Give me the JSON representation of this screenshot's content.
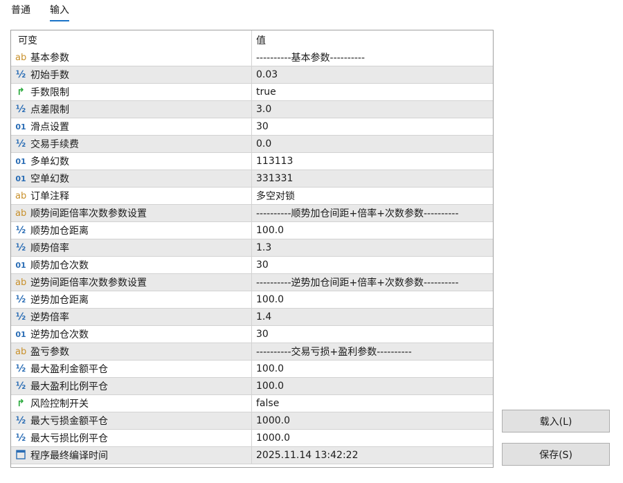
{
  "tabs": [
    {
      "label": "普通",
      "active": false
    },
    {
      "label": "输入",
      "active": true
    }
  ],
  "table": {
    "headers": {
      "name": "可变",
      "value": "值"
    },
    "rows": [
      {
        "type": "ab",
        "name": "基本参数",
        "value": "----------基本参数----------"
      },
      {
        "type": "half",
        "name": "初始手数",
        "value": "0.03"
      },
      {
        "type": "bool",
        "name": "手数限制",
        "value": "true"
      },
      {
        "type": "half",
        "name": "点差限制",
        "value": "3.0"
      },
      {
        "type": "01",
        "name": "滑点设置",
        "value": "30"
      },
      {
        "type": "half",
        "name": "交易手续费",
        "value": "0.0"
      },
      {
        "type": "01",
        "name": "多单幻数",
        "value": "113113"
      },
      {
        "type": "01",
        "name": "空单幻数",
        "value": "331331"
      },
      {
        "type": "ab",
        "name": "订单注释",
        "value": "多空对锁"
      },
      {
        "type": "ab",
        "name": "顺势间距倍率次数参数设置",
        "value": "----------顺势加仓间距+倍率+次数参数----------"
      },
      {
        "type": "half",
        "name": "顺势加仓距离",
        "value": "100.0"
      },
      {
        "type": "half",
        "name": "顺势倍率",
        "value": "1.3"
      },
      {
        "type": "01",
        "name": "顺势加仓次数",
        "value": "30"
      },
      {
        "type": "ab",
        "name": "逆势间距倍率次数参数设置",
        "value": "----------逆势加仓间距+倍率+次数参数----------"
      },
      {
        "type": "half",
        "name": "逆势加仓距离",
        "value": "100.0"
      },
      {
        "type": "half",
        "name": "逆势倍率",
        "value": "1.4"
      },
      {
        "type": "01",
        "name": "逆势加仓次数",
        "value": "30"
      },
      {
        "type": "ab",
        "name": "盈亏参数",
        "value": "----------交易亏损+盈利参数----------"
      },
      {
        "type": "half",
        "name": "最大盈利金额平仓",
        "value": "100.0"
      },
      {
        "type": "half",
        "name": "最大盈利比例平仓",
        "value": "100.0"
      },
      {
        "type": "bool",
        "name": "风险控制开关",
        "value": "false"
      },
      {
        "type": "half",
        "name": "最大亏损金额平仓",
        "value": "1000.0"
      },
      {
        "type": "half",
        "name": "最大亏损比例平仓",
        "value": "1000.0"
      },
      {
        "type": "date",
        "name": "程序最终编译时间",
        "value": "2025.11.14 13:42:22"
      }
    ]
  },
  "buttons": {
    "load": "载入(L)",
    "save": "保存(S)"
  }
}
